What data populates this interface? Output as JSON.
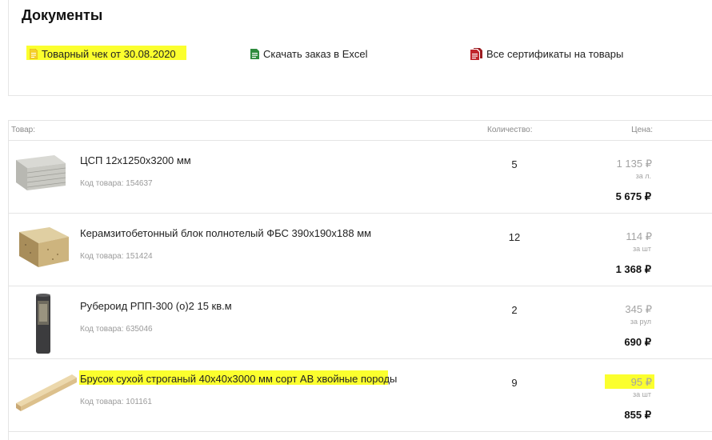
{
  "documents": {
    "title": "Документы",
    "links": [
      {
        "label": "Товарный чек от 30.08.2020",
        "icon": "document-icon",
        "color": "#f0c419"
      },
      {
        "label": "Скачать заказ в Excel",
        "icon": "excel-icon",
        "color": "#2e8b3e"
      },
      {
        "label": "Все сертификаты на товары",
        "icon": "certificates-icon",
        "color": "#c0262c"
      }
    ]
  },
  "table": {
    "headers": {
      "product": "Товар:",
      "quantity": "Количество:",
      "price": "Цена:"
    },
    "rows": [
      {
        "name": "ЦСП 12х1250х3200 мм",
        "code": "Код товара: 154637",
        "qty": "5",
        "unit_price": "1 135 ₽",
        "unit": "за л.",
        "total": "5 675 ₽",
        "image": "cement-board-image"
      },
      {
        "name": "Керамзитобетонный блок полнотелый ФБС 390х190х188 мм",
        "code": "Код товара: 151424",
        "qty": "12",
        "unit_price": "114 ₽",
        "unit": "за шт",
        "total": "1 368 ₽",
        "image": "concrete-block-image"
      },
      {
        "name": "Рубероид РПП-300 (о)2 15 кв.м",
        "code": "Код товара: 635046",
        "qty": "2",
        "unit_price": "345 ₽",
        "unit": "за рул",
        "total": "690 ₽",
        "image": "roofing-roll-image"
      },
      {
        "name": "Брусок сухой строганый 40х40х3000 мм сорт АВ хвойные породы",
        "code": "Код товара: 101161",
        "qty": "9",
        "unit_price": "95 ₽",
        "unit": "за шт",
        "total": "855 ₽",
        "image": "wood-bar-image"
      }
    ]
  },
  "highlight_color": "#fbff2e"
}
